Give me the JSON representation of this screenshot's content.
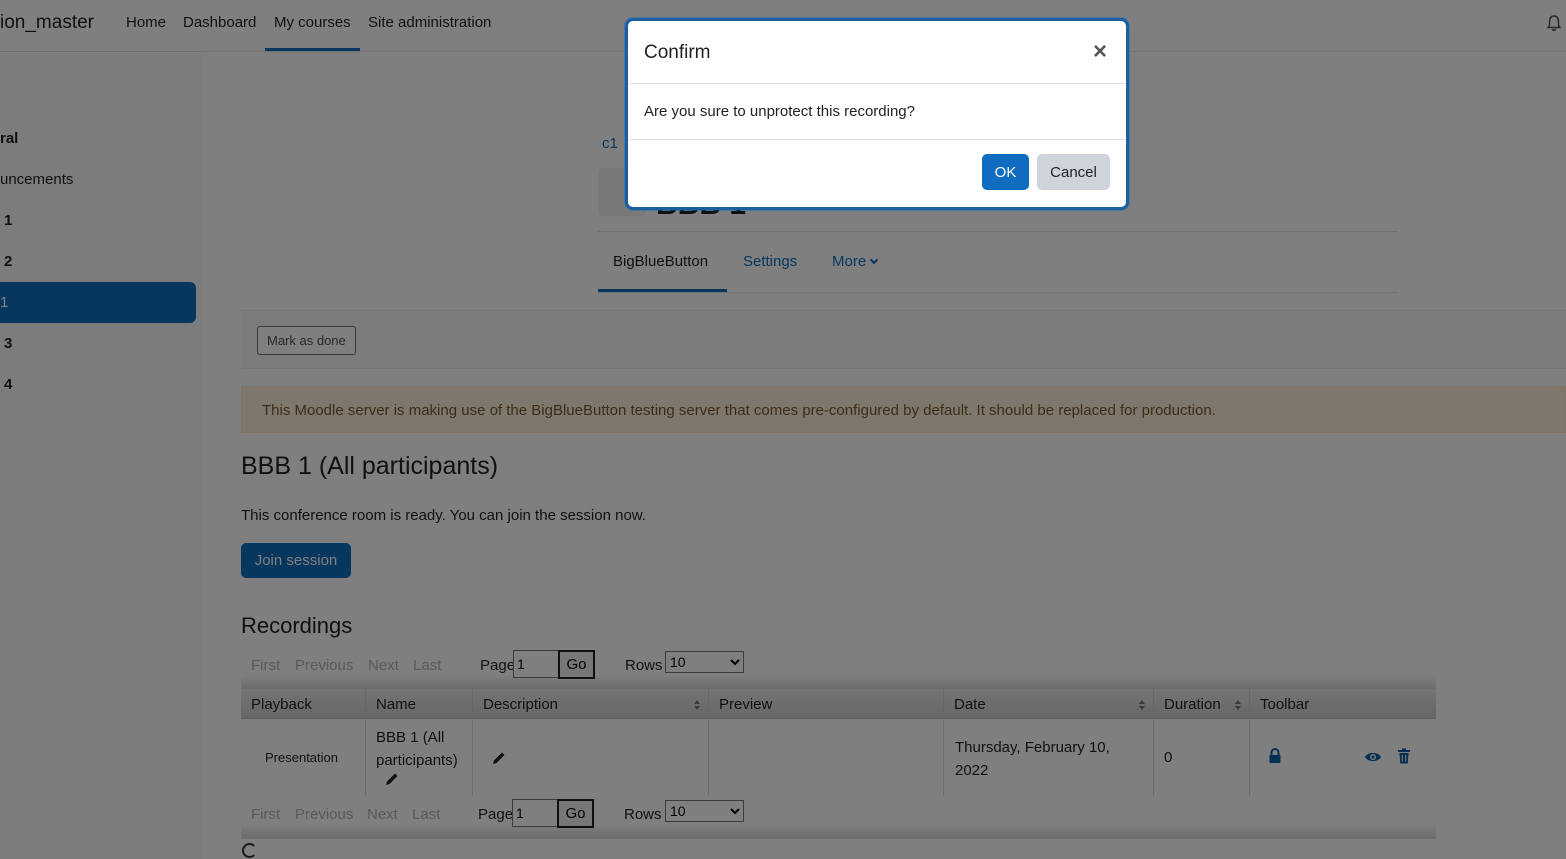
{
  "navbar": {
    "brand": "ion_master",
    "links": [
      "Home",
      "Dashboard",
      "My courses",
      "Site administration"
    ]
  },
  "drawer": {
    "items": [
      "ral",
      "uncements",
      "1",
      "2",
      "1",
      "3",
      "4"
    ]
  },
  "breadcrumb": "c1",
  "activity": {
    "title": "BBB 1"
  },
  "secondary_nav": {
    "tabs": [
      "BigBlueButton",
      "Settings",
      "More"
    ]
  },
  "completion": {
    "mark_done": "Mark as done"
  },
  "alert": "This Moodle server is making use of the BigBlueButton testing server that comes pre-configured by default. It should be replaced for production.",
  "room": {
    "title": "BBB 1 (All participants)",
    "status": "This conference room is ready. You can join the session now.",
    "join_label": "Join session"
  },
  "recordings": {
    "title": "Recordings",
    "pager": {
      "first": "First",
      "previous": "Previous",
      "next": "Next",
      "last": "Last",
      "page_label": "Page",
      "page_value": "1",
      "go": "Go",
      "rows_label": "Rows",
      "rows_value": "10"
    },
    "columns": [
      "Playback",
      "Name",
      "Description",
      "Preview",
      "Date",
      "Duration",
      "Toolbar"
    ],
    "rows": [
      {
        "playback": "Presentation",
        "name": "BBB 1 (All participants)",
        "description": "",
        "preview": "",
        "date": "Thursday, February 10, 2022",
        "duration": "0"
      }
    ]
  },
  "modal": {
    "title": "Confirm",
    "close": "×",
    "message": "Are you sure to unprotect this recording?",
    "ok": "OK",
    "cancel": "Cancel"
  },
  "colors": {
    "primary": "#0f6cbf",
    "alert_bg": "#fcefdc",
    "alert_text": "#7d5a29"
  }
}
